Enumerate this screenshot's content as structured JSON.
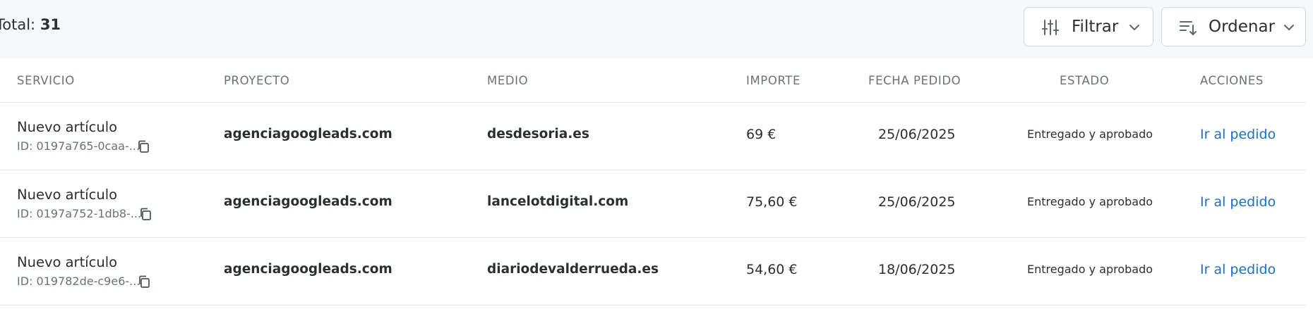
{
  "summary": {
    "total_label": "Total:",
    "total_count": "31"
  },
  "toolbar": {
    "filter_label": "Filtrar",
    "order_label": "Ordenar"
  },
  "table": {
    "headers": {
      "service": "SERVICIO",
      "project": "PROYECTO",
      "medium": "MEDIO",
      "amount": "IMPORTE",
      "date": "FECHA PEDIDO",
      "status": "ESTADO",
      "actions": "ACCIONES"
    },
    "rows": [
      {
        "service": "Nuevo artículo",
        "id": "ID: 0197a765-0caa-...",
        "project": "agenciagoogleads.com",
        "medium": "desdesoria.es",
        "amount": "69 €",
        "date": "25/06/2025",
        "status": "Entregado y aprobado",
        "action": "Ir al pedido"
      },
      {
        "service": "Nuevo artículo",
        "id": "ID: 0197a752-1db8-...",
        "project": "agenciagoogleads.com",
        "medium": "lancelotdigital.com",
        "amount": "75,60 €",
        "date": "25/06/2025",
        "status": "Entregado y aprobado",
        "action": "Ir al pedido"
      },
      {
        "service": "Nuevo artículo",
        "id": "ID: 019782de-c9e6-...",
        "project": "agenciagoogleads.com",
        "medium": "diariodevalderrueda.es",
        "amount": "54,60 €",
        "date": "18/06/2025",
        "status": "Entregado y aprobado",
        "action": "Ir al pedido"
      }
    ]
  },
  "colors": {
    "link": "#1f6fc5",
    "header_text": "#6b7178",
    "topbar_bg": "#f7f8fa"
  },
  "icons": {
    "filter": "sliders-icon",
    "order": "sort-icon",
    "chevron": "chevron-down-icon",
    "copy": "copy-icon"
  }
}
